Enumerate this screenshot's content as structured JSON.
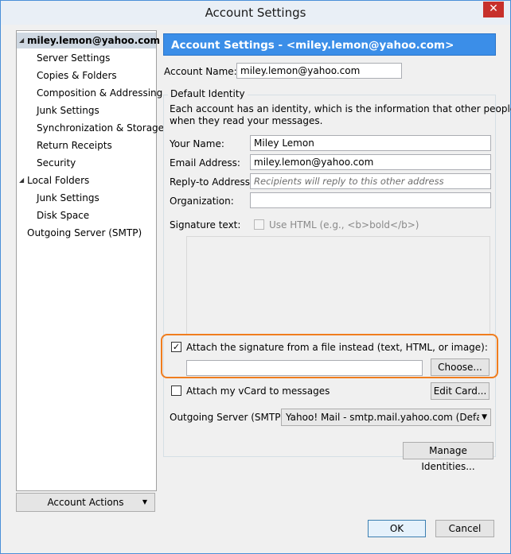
{
  "window": {
    "title": "Account Settings"
  },
  "sidebar": {
    "items": [
      {
        "label": "miley.lemon@yahoo.com",
        "level": 0,
        "expanded": true,
        "selected": true
      },
      {
        "label": "Server Settings",
        "level": 1
      },
      {
        "label": "Copies & Folders",
        "level": 1
      },
      {
        "label": "Composition & Addressing",
        "level": 1
      },
      {
        "label": "Junk Settings",
        "level": 1
      },
      {
        "label": "Synchronization & Storage",
        "level": 1
      },
      {
        "label": "Return Receipts",
        "level": 1
      },
      {
        "label": "Security",
        "level": 1
      },
      {
        "label": "Local Folders",
        "level": 0,
        "expanded": true
      },
      {
        "label": "Junk Settings",
        "level": 1
      },
      {
        "label": "Disk Space",
        "level": 1
      },
      {
        "label": "Outgoing Server (SMTP)",
        "level": 0
      }
    ],
    "account_actions_label": "Account Actions"
  },
  "panel": {
    "header": "Account Settings - <miley.lemon@yahoo.com>",
    "account_name_label": "Account Name:",
    "account_name_value": "miley.lemon@yahoo.com",
    "group_title": "Default Identity",
    "identity_desc_line1": "Each account has an identity, which is the information that other people see",
    "identity_desc_line2": "when they read your messages.",
    "your_name_label": "Your Name:",
    "your_name_value": "Miley Lemon",
    "email_label": "Email Address:",
    "email_value": "miley.lemon@yahoo.com",
    "reply_to_label": "Reply-to Address:",
    "reply_to_placeholder": "Recipients will reply to this other address",
    "organization_label": "Organization:",
    "organization_value": "",
    "signature_label": "Signature text:",
    "use_html_label": "Use HTML (e.g., <b>bold</b>)",
    "attach_signature_label": "Attach the signature from a file instead (text, HTML, or image):",
    "attach_signature_checked": true,
    "signature_file_value": "",
    "choose_label": "Choose...",
    "attach_vcard_label": "Attach my vCard to messages",
    "attach_vcard_checked": false,
    "edit_card_label": "Edit Card...",
    "outgoing_server_label": "Outgoing Server (SMTP):",
    "outgoing_server_value": "Yahoo! Mail - smtp.mail.yahoo.com (Defau",
    "manage_identities_label": "Manage Identities..."
  },
  "footer": {
    "ok_label": "OK",
    "cancel_label": "Cancel"
  },
  "colors": {
    "header_bg": "#3b8ee8",
    "highlight": "#f07d1e",
    "close": "#c7302b"
  }
}
